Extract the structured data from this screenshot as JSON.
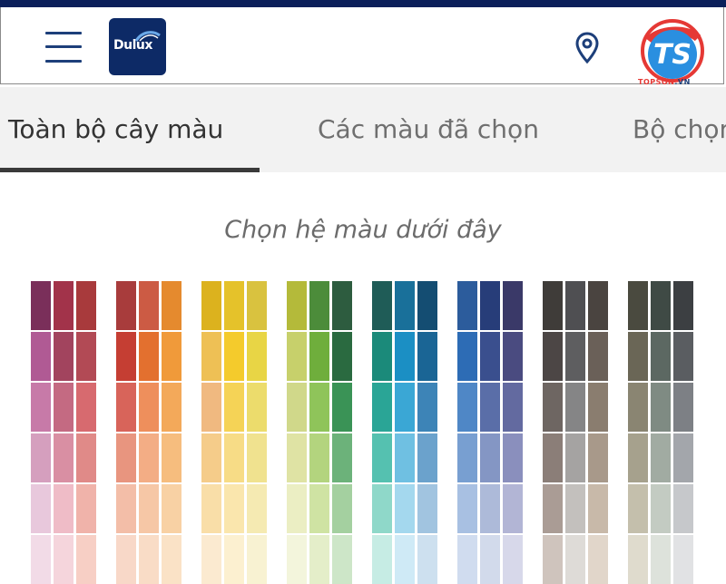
{
  "header": {
    "menu_icon": "hamburger-menu-icon",
    "logo_text": "Dulux",
    "location_icon": "map-pin-icon",
    "watermark_caption_part1": "TOPSON",
    "watermark_caption_part2": ".VN",
    "watermark_letters": "TS"
  },
  "tabs": [
    {
      "label": "Toàn bộ cây màu",
      "active": true
    },
    {
      "label": "Các màu đã chọn",
      "active": false
    },
    {
      "label": "Bộ chọn",
      "active": false
    }
  ],
  "subtitle": "Chọn hệ màu dưới đây",
  "palette": {
    "families": [
      {
        "name": "red-purple",
        "columns": [
          [
            "#7a2f5a",
            "#b05a94",
            "#c77aa8",
            "#d59fbe",
            "#e8c8dc",
            "#f2dbe7"
          ],
          [
            "#a2334a",
            "#a2445e",
            "#c46a82",
            "#d98fa3",
            "#efbcc7",
            "#f5d5dc"
          ],
          [
            "#a83a3c",
            "#b24a55",
            "#d76a6f",
            "#e08a88",
            "#f0b3aa",
            "#f7cfc5"
          ]
        ]
      },
      {
        "name": "red-orange",
        "columns": [
          [
            "#a83c3c",
            "#c53e33",
            "#d8645a",
            "#e8957f",
            "#f3bea8",
            "#f8d8c8"
          ],
          [
            "#cc5b44",
            "#e3702f",
            "#ee8f5c",
            "#f3ad85",
            "#f6c7a6",
            "#f9dcc6"
          ],
          [
            "#e58a2e",
            "#f09a3a",
            "#f3a95a",
            "#f6bd7e",
            "#f8d1a4",
            "#fae2c6"
          ]
        ]
      },
      {
        "name": "yellow",
        "columns": [
          [
            "#dcb21e",
            "#eec055",
            "#f0b980",
            "#f5cc8a",
            "#f9dea8",
            "#fbead0"
          ],
          [
            "#e5c22a",
            "#f4cb2c",
            "#f5d356",
            "#f7dc86",
            "#fae6ad",
            "#fcf0d0"
          ],
          [
            "#d9c23f",
            "#e8d545",
            "#ecdc6c",
            "#f0e28f",
            "#f5eab2",
            "#f8f2d2"
          ]
        ]
      },
      {
        "name": "green",
        "columns": [
          [
            "#b4ba3a",
            "#c7d06b",
            "#d0d88a",
            "#dfe3a4",
            "#ebeec3",
            "#f3f5dc"
          ],
          [
            "#4c8c3a",
            "#6fae3c",
            "#8fc45a",
            "#b3d47e",
            "#cfe3a3",
            "#e4eec9"
          ],
          [
            "#2d5c3f",
            "#2a6a40",
            "#3a9356",
            "#6cb27a",
            "#a4d0a0",
            "#cde6c8"
          ]
        ]
      },
      {
        "name": "teal",
        "columns": [
          [
            "#1f5c57",
            "#1b8a7a",
            "#2aa596",
            "#55c1b0",
            "#8fd8c9",
            "#c6ece4"
          ],
          [
            "#19709a",
            "#1b8fc4",
            "#3aa7d5",
            "#6fc0e2",
            "#a4d8ee",
            "#cfeaf6"
          ],
          [
            "#144d72",
            "#1a6595",
            "#3d84b7",
            "#6ba2cc",
            "#a1c4e0",
            "#cde0ef"
          ]
        ]
      },
      {
        "name": "blue",
        "columns": [
          [
            "#2c5c9c",
            "#2d6cb5",
            "#4f87c6",
            "#789fd1",
            "#a8c0e2",
            "#d0dcef"
          ],
          [
            "#273d79",
            "#3a4f8e",
            "#5a6ea8",
            "#8496c4",
            "#adbad9",
            "#d2daeb"
          ],
          [
            "#3a3968",
            "#4a4b80",
            "#636aa0",
            "#8a8fbd",
            "#b2b5d5",
            "#d7d8ea"
          ]
        ]
      },
      {
        "name": "neutral-dark",
        "columns": [
          [
            "#3f3c39",
            "#4c4645",
            "#6e6662",
            "#8b7e78",
            "#aa9c95",
            "#cfc4bd"
          ],
          [
            "#4f4f52",
            "#5e5e60",
            "#858586",
            "#a5a3a2",
            "#c3c0bd",
            "#dedbd7"
          ],
          [
            "#4a4440",
            "#6a6058",
            "#8a7d6f",
            "#a8998a",
            "#c8b9a9",
            "#e1d6ca"
          ]
        ]
      },
      {
        "name": "neutral-grey",
        "columns": [
          [
            "#4a4a3f",
            "#6a6656",
            "#8a8572",
            "#a6a18d",
            "#c4bfac",
            "#dfdbcd"
          ],
          [
            "#3f4a45",
            "#5c6862",
            "#7f8b83",
            "#a1aba2",
            "#c3cbc2",
            "#dde2db"
          ],
          [
            "#3c3f42",
            "#5a5d61",
            "#7d8085",
            "#a3a6ab",
            "#c6c8cb",
            "#e1e2e4"
          ]
        ]
      }
    ]
  }
}
